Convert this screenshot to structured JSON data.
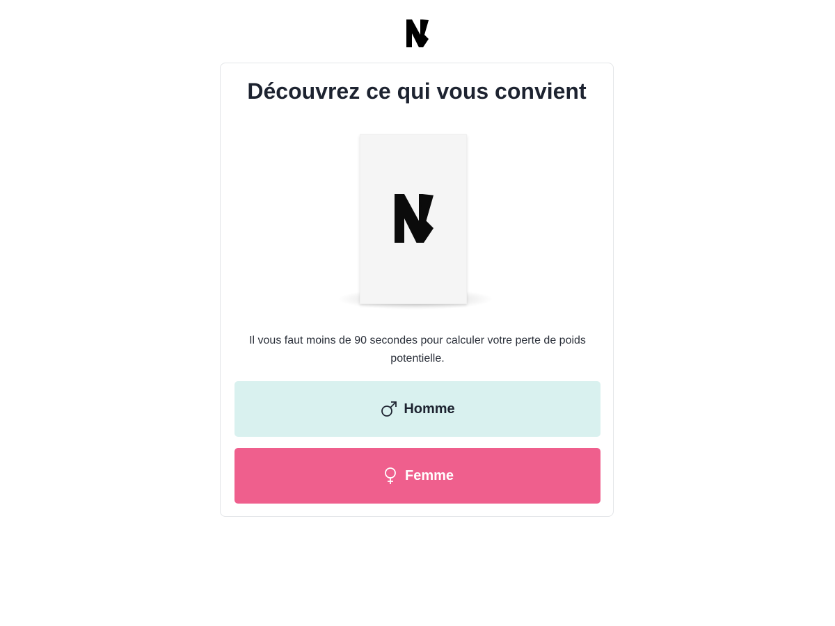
{
  "brand": {
    "logo_letter": "N"
  },
  "card": {
    "title": "Découvrez ce qui vous convient",
    "intro": "Il vous faut moins de 90 secondes pour calculer votre perte de poids potentielle."
  },
  "choices": {
    "male": {
      "label": "Homme",
      "icon": "male-symbol-icon",
      "background": "#d9f1ef"
    },
    "female": {
      "label": "Femme",
      "icon": "female-symbol-icon",
      "background": "#ef5f8d"
    }
  },
  "colors": {
    "text": "#1d2330",
    "card_border": "#e3e5e8",
    "product_box": "#f5f5f5"
  }
}
